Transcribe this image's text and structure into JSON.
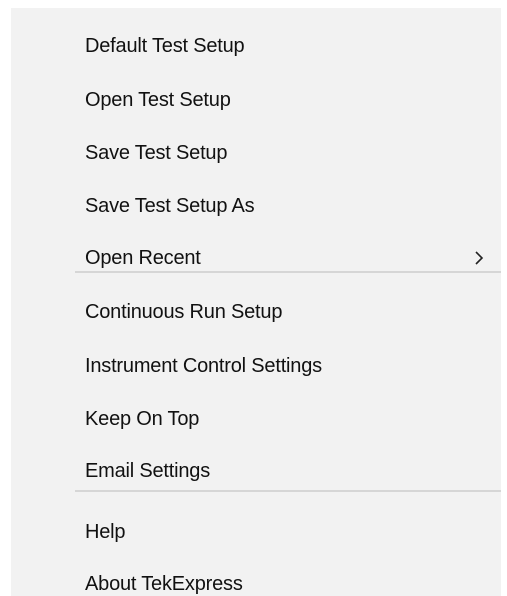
{
  "menu": {
    "group1": [
      {
        "label": "Default Test Setup"
      },
      {
        "label": "Open Test Setup"
      },
      {
        "label": "Save Test Setup"
      },
      {
        "label": "Save Test Setup As"
      },
      {
        "label": "Open Recent",
        "has_submenu": true
      }
    ],
    "group2": [
      {
        "label": "Continuous Run Setup"
      },
      {
        "label": "Instrument Control Settings"
      },
      {
        "label": "Keep On Top"
      },
      {
        "label": "Email Settings"
      }
    ],
    "group3": [
      {
        "label": "Help"
      },
      {
        "label": "About TekExpress"
      }
    ]
  },
  "colors": {
    "menu_background": "#f2f2f2",
    "separator": "#d6d6d6",
    "text": "#111111"
  },
  "icons": {
    "submenu": "chevron-right-icon"
  }
}
